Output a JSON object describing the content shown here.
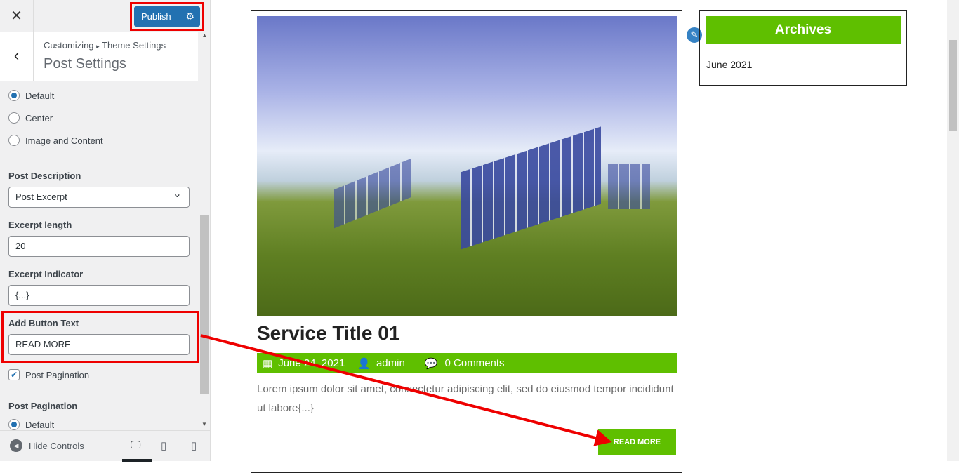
{
  "customizer": {
    "close_icon": "close-icon",
    "publish_label": "Publish",
    "breadcrumb_root": "Customizing",
    "breadcrumb_sep": "▸",
    "breadcrumb_section": "Theme Settings",
    "title": "Post Settings",
    "layout_options": [
      {
        "label": "Default",
        "checked": true
      },
      {
        "label": "Center",
        "checked": false
      },
      {
        "label": "Image and Content",
        "checked": false
      }
    ],
    "post_description_label": "Post Description",
    "post_description_value": "Post Excerpt",
    "excerpt_length_label": "Excerpt length",
    "excerpt_length_value": "20",
    "excerpt_indicator_label": "Excerpt Indicator",
    "excerpt_indicator_value": "{...}",
    "button_text_label": "Add Button Text",
    "button_text_value": "READ MORE",
    "pagination_checkbox_label": "Post Pagination",
    "pagination_checked": true,
    "pagination_label": "Post Pagination",
    "pagination_option": "Default",
    "hide_controls": "Hide Controls"
  },
  "preview": {
    "post_title": "Service Title 01",
    "date": "June 24, 2021",
    "author": "admin",
    "comments": "0 Comments",
    "excerpt": "Lorem ipsum dolor sit amet, consectetur adipiscing elit, sed do eiusmod tempor incididunt ut labore{...}",
    "read_more": "READ MORE",
    "widget_title": "Archives",
    "archive_link": "June 2021",
    "accent": "#5fbf00",
    "annotation_color": "#e00000"
  }
}
